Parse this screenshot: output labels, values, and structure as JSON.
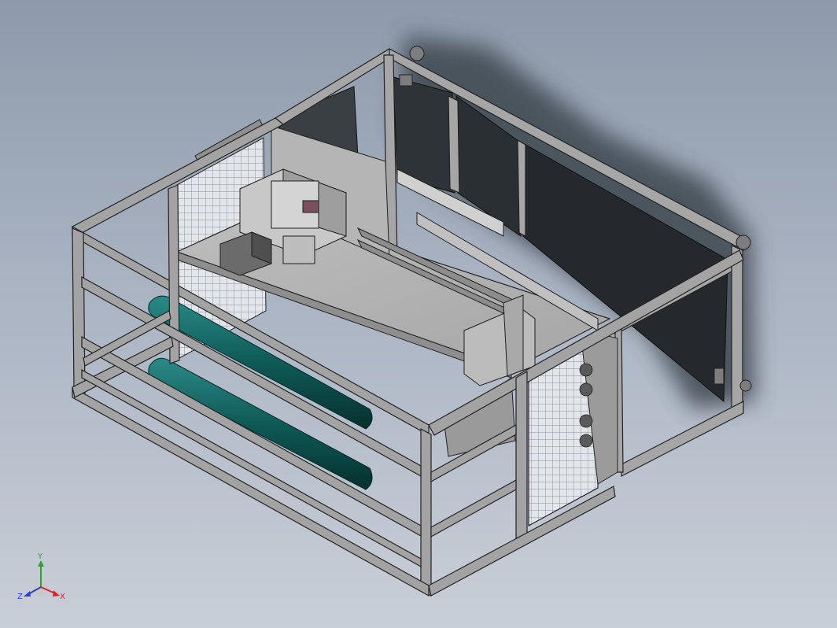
{
  "viewport": {
    "background_top": "#8e9aab",
    "background_bottom": "#c9cfd8",
    "frame_color": "#a3a3a3",
    "frame_edge": "#222222",
    "roller_color": "#0e5a57",
    "mesh_color": "#e2e5ea"
  },
  "triad": {
    "x_label": "X",
    "y_label": "Y",
    "z_label": "Z",
    "x_color": "#d8262b",
    "y_color": "#2aa52a",
    "z_color": "#2a3fd1"
  }
}
